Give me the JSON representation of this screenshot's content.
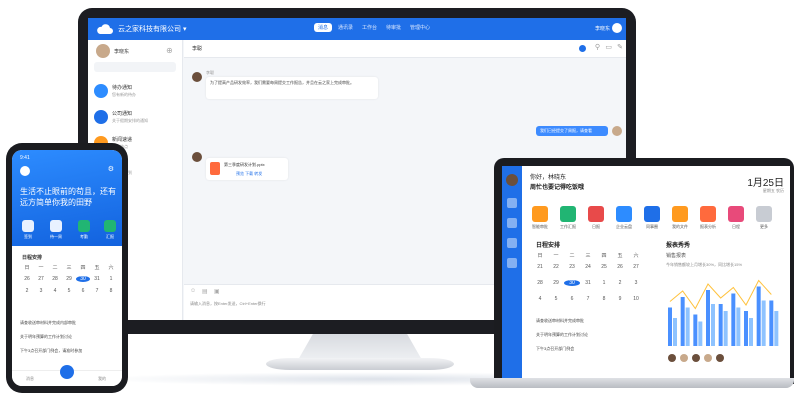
{
  "monitor": {
    "company": "云之家科技有限公司 ▾",
    "nav": [
      "消息",
      "通讯录",
      "工作台",
      "待审批",
      "管理中心"
    ],
    "nav_active_index": 0,
    "user_name": "李晓东",
    "sidebar": {
      "user": "李晓东",
      "items": [
        {
          "label": "待办通知",
          "sub": "您有新的待办",
          "color": "#2d8cff"
        },
        {
          "label": "公司通知",
          "sub": "关于假期安排的通知",
          "color": "#1f6fe8"
        },
        {
          "label": "新闻速递",
          "sub": "本周热点",
          "color": "#ff9a1f"
        },
        {
          "label": "李明",
          "sub": "好的，收到",
          "color": "#6b4f3c"
        }
      ]
    },
    "chat": {
      "title": "李聪",
      "msg1_name": "李聪",
      "msg1_text": "为了提高产品研发效率，我们需要每周提交工作报告，并且在云之家上完成审批。",
      "msg2_text": "我们已经提交了周报，请查看",
      "file_name": "第三季度研发计划.pptx",
      "file_actions": "预览  下载  转发",
      "input_hint": "请输入消息，按Enter发送，Ctrl+Enter换行"
    }
  },
  "phone": {
    "time": "9:41",
    "slogan": "生活不止眼前的苟且，还有远方简单你我的田野",
    "apps": [
      "签到",
      "待一周",
      "考勤",
      "汇报"
    ],
    "cal_title": "日程安排",
    "weekdays": [
      "日",
      "一",
      "二",
      "三",
      "四",
      "五",
      "六"
    ],
    "days": [
      "26",
      "27",
      "28",
      "29",
      "30",
      "31",
      "1",
      "2",
      "3",
      "4",
      "5",
      "6",
      "7",
      "8"
    ],
    "selected_day": "30",
    "tasks": [
      "请查收送审材料并完成内部审批",
      "关于明年预算的工作计划讨论",
      "下午3点召开部门例会，请准时参加"
    ],
    "nav": [
      "消息",
      "",
      "我的"
    ]
  },
  "laptop": {
    "greet1": "你好，林晓东",
    "greet2": "周忙也要记得吃饭哦",
    "date": "1月25日",
    "date_sub": "星期五 农历",
    "apps": [
      {
        "label": "智能审批",
        "color": "#ff9a1f"
      },
      {
        "label": "工作汇报",
        "color": "#21b573"
      },
      {
        "label": "日报",
        "color": "#e84a4a"
      },
      {
        "label": "企业云盘",
        "color": "#2d8cff"
      },
      {
        "label": "同事圈",
        "color": "#1f6fe8"
      },
      {
        "label": "我的文件",
        "color": "#ff9a1f"
      },
      {
        "label": "报表分析",
        "color": "#ff6a3d"
      },
      {
        "label": "日程",
        "color": "#e84a7a"
      },
      {
        "label": "更多",
        "color": "#c8ccd3"
      }
    ],
    "cal_title": "日程安排",
    "weekdays": [
      "日",
      "一",
      "二",
      "三",
      "四",
      "五",
      "六"
    ],
    "days": [
      "21",
      "22",
      "23",
      "24",
      "25",
      "26",
      "27",
      "28",
      "29",
      "30",
      "31",
      "1",
      "2",
      "3",
      "4",
      "5",
      "6",
      "7",
      "8",
      "9",
      "10"
    ],
    "selected_day": "30",
    "tasks": [
      "请查收送审材料并完成审批",
      "关于明年预算的工作计划讨论",
      "下午3点召开部门例会"
    ],
    "report_title": "报表秀秀",
    "report_sub": "销售报表",
    "report_legend": "今年销售额较上月增长30%，同比增长15%",
    "chart_data": {
      "type": "bar",
      "categories": [
        "1",
        "2",
        "3",
        "4",
        "5",
        "6",
        "7",
        "8",
        "9"
      ],
      "series": [
        {
          "values": [
            55,
            70,
            45,
            80,
            60,
            75,
            50,
            85,
            65
          ],
          "color": "#4a90ff"
        },
        {
          "values": [
            40,
            55,
            35,
            60,
            50,
            55,
            40,
            65,
            50
          ],
          "color": "#8ec3ff"
        }
      ],
      "ylim": [
        0,
        100
      ]
    }
  }
}
